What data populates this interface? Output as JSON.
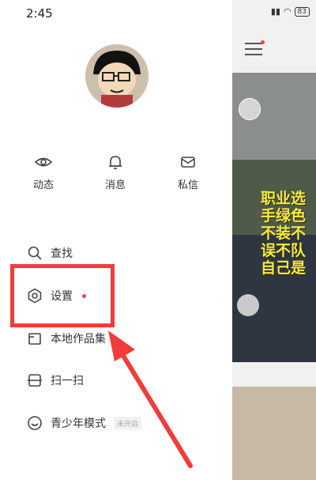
{
  "status_bar": {
    "time": "2:45",
    "battery": "83"
  },
  "quick_actions": [
    {
      "label": "动态",
      "icon": "eye-icon"
    },
    {
      "label": "消息",
      "icon": "bell-icon"
    },
    {
      "label": "私信",
      "icon": "mail-icon"
    }
  ],
  "menu": {
    "search": {
      "label": "查找",
      "icon": "search-icon"
    },
    "settings": {
      "label": "设置",
      "icon": "hexagon-settings-icon"
    },
    "local_works": {
      "label": "本地作品集",
      "icon": "folder-icon"
    },
    "scan": {
      "label": "扫一扫",
      "icon": "scan-icon"
    },
    "youth_mode": {
      "label": "青少年模式",
      "icon": "smiley-icon",
      "tag": "未开启"
    }
  },
  "feed": {
    "video_caption": "职业选手绿色不装不误不队自己是"
  },
  "colors": {
    "highlight": "#f23b3b",
    "dot": "#f0404a",
    "caption": "#f7ec3a"
  }
}
